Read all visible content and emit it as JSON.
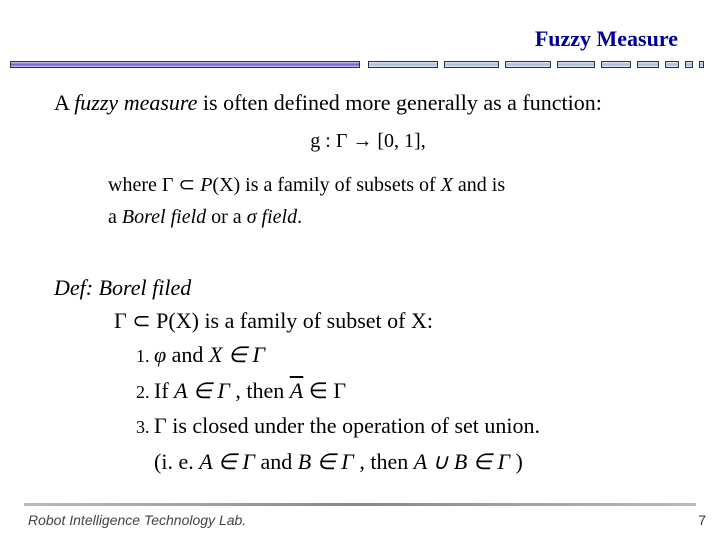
{
  "title": "Fuzzy Measure",
  "intro": {
    "pre": "A ",
    "em": "fuzzy measure",
    "post": " is often defined more generally as a function:"
  },
  "math_map": "g : Γ → [0, 1],",
  "math_where": {
    "pre": "where Γ ⊂ ",
    "px": "P",
    "arg": "(X)",
    "mid": " is a family of subsets of ",
    "xvar": "X",
    "post": " and is"
  },
  "math_borel": {
    "pre": "a ",
    "b1": "Borel field",
    "or": " or a ",
    "b2": "σ field",
    "end": "."
  },
  "def": {
    "label": "Def: Borel filed",
    "family": {
      "gamma": "Γ ⊂ P(X)",
      "rest": " is a family of subset of  X:"
    },
    "item1": {
      "phi": "φ",
      "and_text": "  and  ",
      "xin": "X ∈ Γ"
    },
    "item2": {
      "if_text": "If  ",
      "ain": "A ∈ Γ",
      "then_text": " , then  ",
      "abar": "A",
      "post": " ∈ Γ"
    },
    "item3": {
      "gamma": "Γ",
      "text": " is closed under the operation of set union."
    },
    "ie": {
      "open": "(i. e.    ",
      "a": "A ∈ Γ",
      "and": "   and  ",
      "b": "B ∈ Γ",
      "then": " , then  ",
      "ab": "A ∪ B ∈ Γ",
      "close": " )"
    }
  },
  "footer": "Robot Intelligence Technology Lab.",
  "page": "7"
}
